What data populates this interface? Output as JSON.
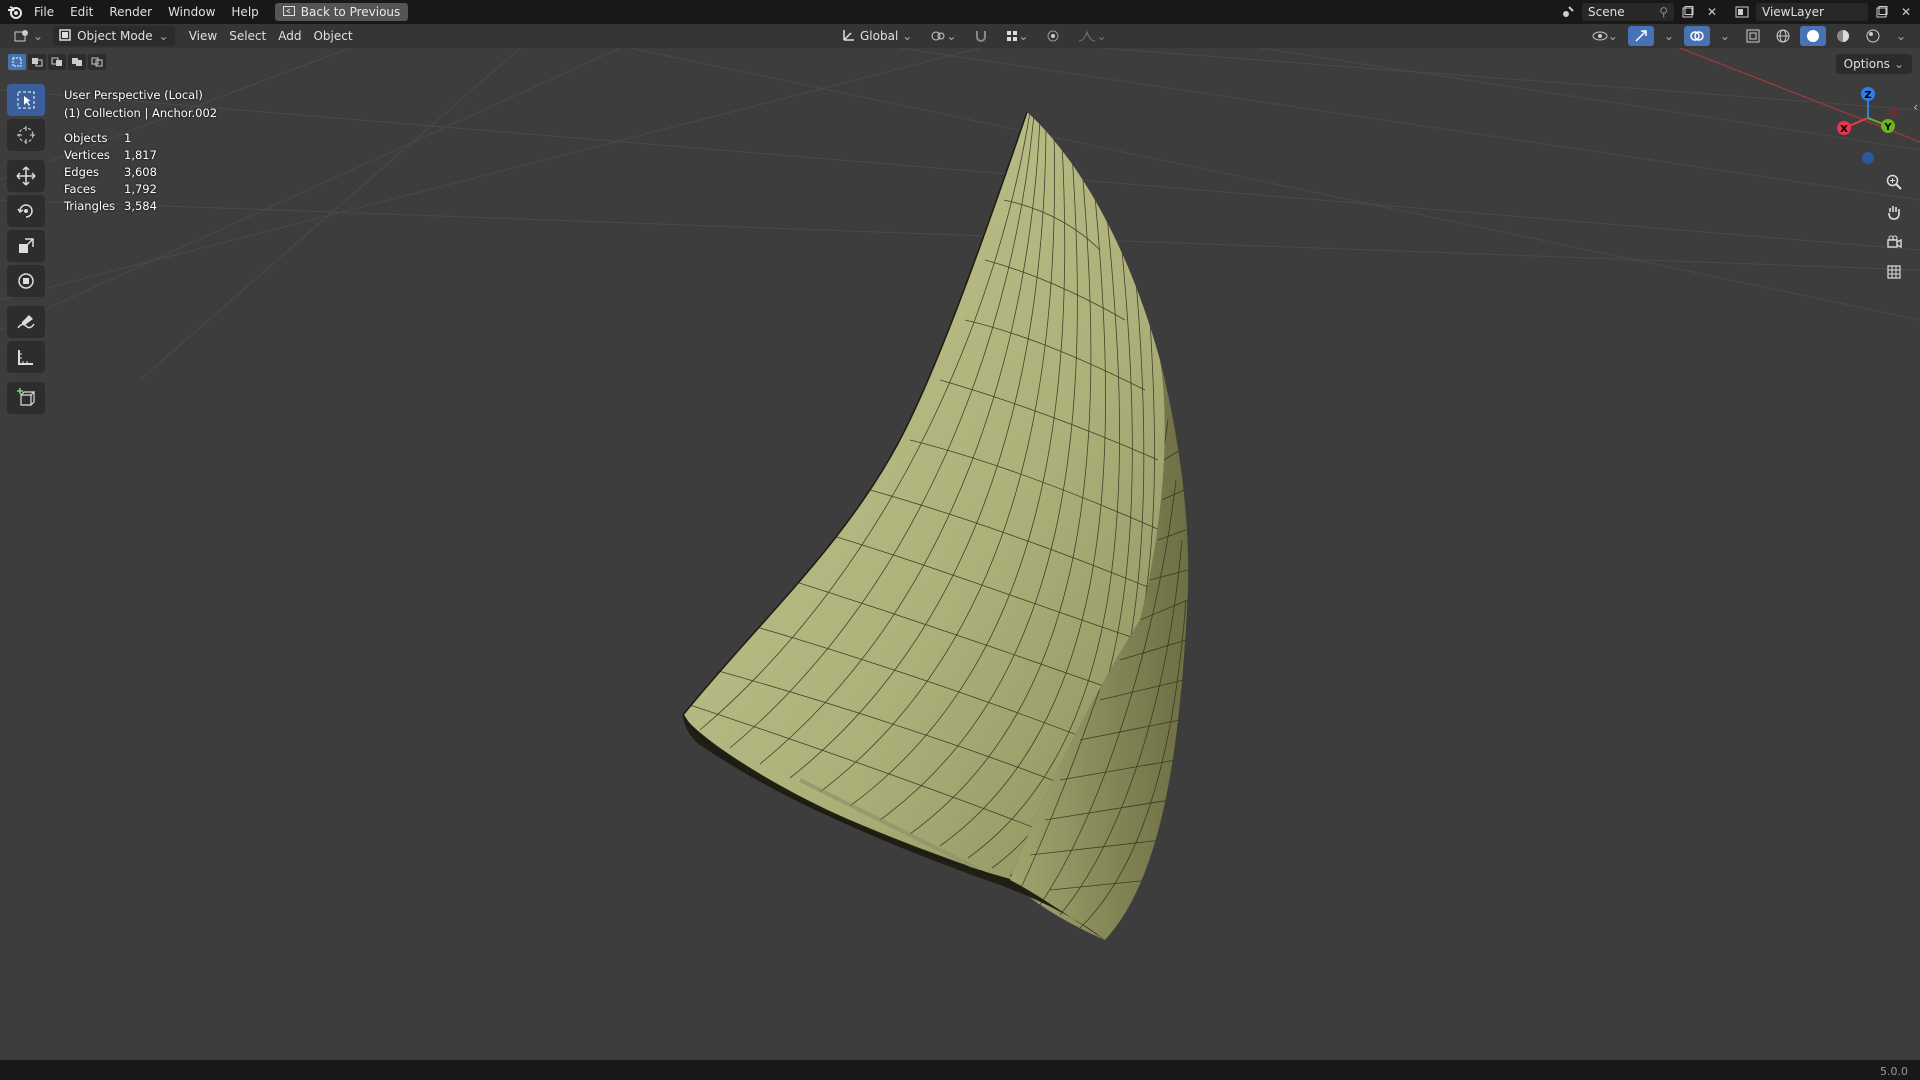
{
  "menubar": {
    "items": [
      "File",
      "Edit",
      "Render",
      "Window",
      "Help"
    ],
    "back_button": "Back to Previous",
    "scene": "Scene",
    "view_layer": "ViewLayer"
  },
  "header": {
    "mode": "Object Mode",
    "menus": [
      "View",
      "Select",
      "Add",
      "Object"
    ],
    "orientation": "Global"
  },
  "viewport": {
    "perspective": "User Perspective (Local)",
    "collection": "(1) Collection | Anchor.002",
    "options_label": "Options"
  },
  "stats": [
    {
      "label": "Objects",
      "value": "1"
    },
    {
      "label": "Vertices",
      "value": "1,817"
    },
    {
      "label": "Edges",
      "value": "3,608"
    },
    {
      "label": "Faces",
      "value": "1,792"
    },
    {
      "label": "Triangles",
      "value": "3,584"
    }
  ],
  "gizmo": {
    "x": "X",
    "y": "Y",
    "z": "Z"
  },
  "statusbar": {
    "version": "5.0.0"
  },
  "colors": {
    "accent": "#4772b3",
    "x_axis": "#e8364f",
    "y_axis": "#6cb51f",
    "z_axis": "#2d7ee8",
    "mesh": "#b3b580"
  },
  "icons": [
    "blender-logo-icon",
    "back-icon",
    "editor-type-icon",
    "mode-icon",
    "select-box-icon",
    "cursor-icon",
    "move-icon",
    "rotate-icon",
    "scale-icon",
    "transform-icon",
    "annotate-icon",
    "measure-icon",
    "add-cube-icon",
    "zoom-icon",
    "hand-icon",
    "camera-icon",
    "grid-icon"
  ]
}
